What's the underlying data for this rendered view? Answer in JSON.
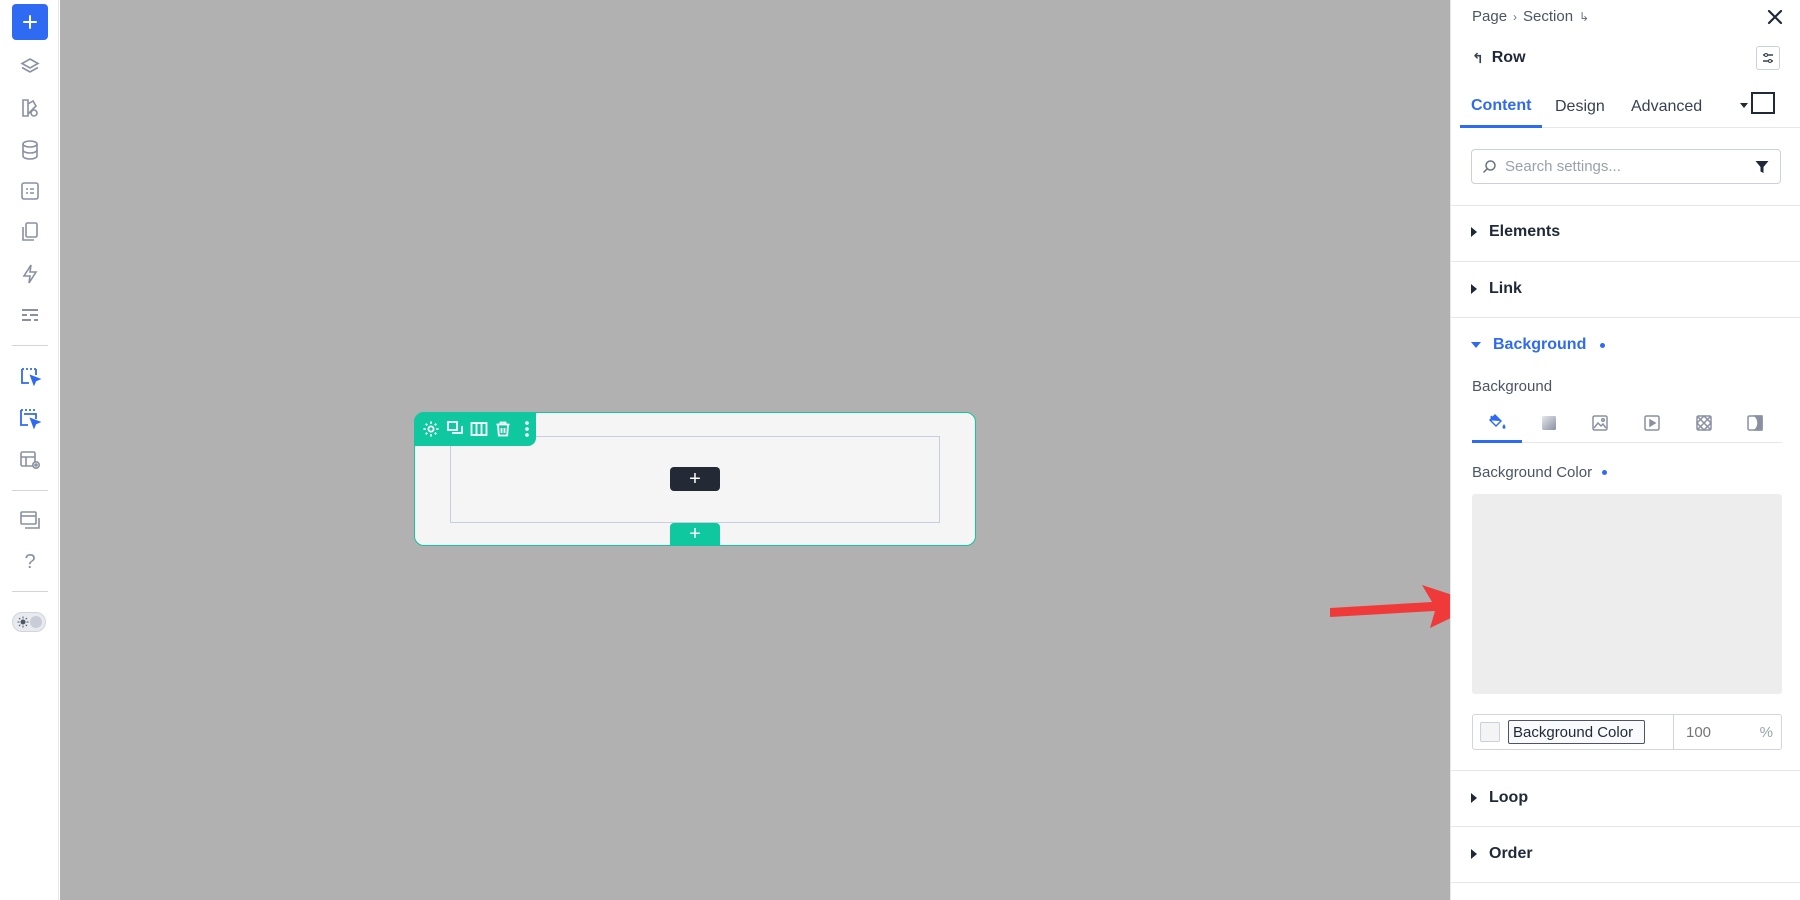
{
  "sidebar": {
    "add_label": "+",
    "help_label": "?"
  },
  "canvas": {
    "add_element_label": "+",
    "add_row_label": "+"
  },
  "panel": {
    "breadcrumb": [
      "Page",
      "Section"
    ],
    "element_title": "Row",
    "tabs": [
      "Content",
      "Design",
      "Advanced"
    ],
    "active_tab": "Content",
    "search_placeholder": "Search settings...",
    "sections": {
      "elements": "Elements",
      "link": "Link",
      "background": "Background",
      "loop": "Loop",
      "order": "Order"
    },
    "background_label": "Background",
    "background_color_label": "Background Color",
    "color_name_value": "Background Color",
    "opacity_value": "100",
    "opacity_unit": "%"
  },
  "colors": {
    "accent": "#2f6bf2",
    "builder_green": "#10c8a0",
    "canvas_bg": "#b1b1b1",
    "arrow_red": "#f03a3a"
  }
}
